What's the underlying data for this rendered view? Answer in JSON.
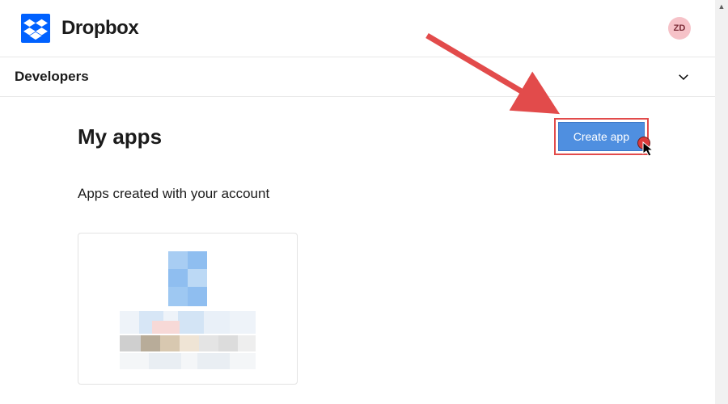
{
  "header": {
    "brand": "Dropbox",
    "avatar_initials": "ZD"
  },
  "devbar": {
    "title": "Developers"
  },
  "main": {
    "heading": "My apps",
    "create_button": "Create app",
    "subtitle": "Apps created with your account"
  },
  "colors": {
    "brand_blue": "#0061ff",
    "button_blue": "#4f8fe0",
    "highlight_red": "#e24b4b"
  }
}
